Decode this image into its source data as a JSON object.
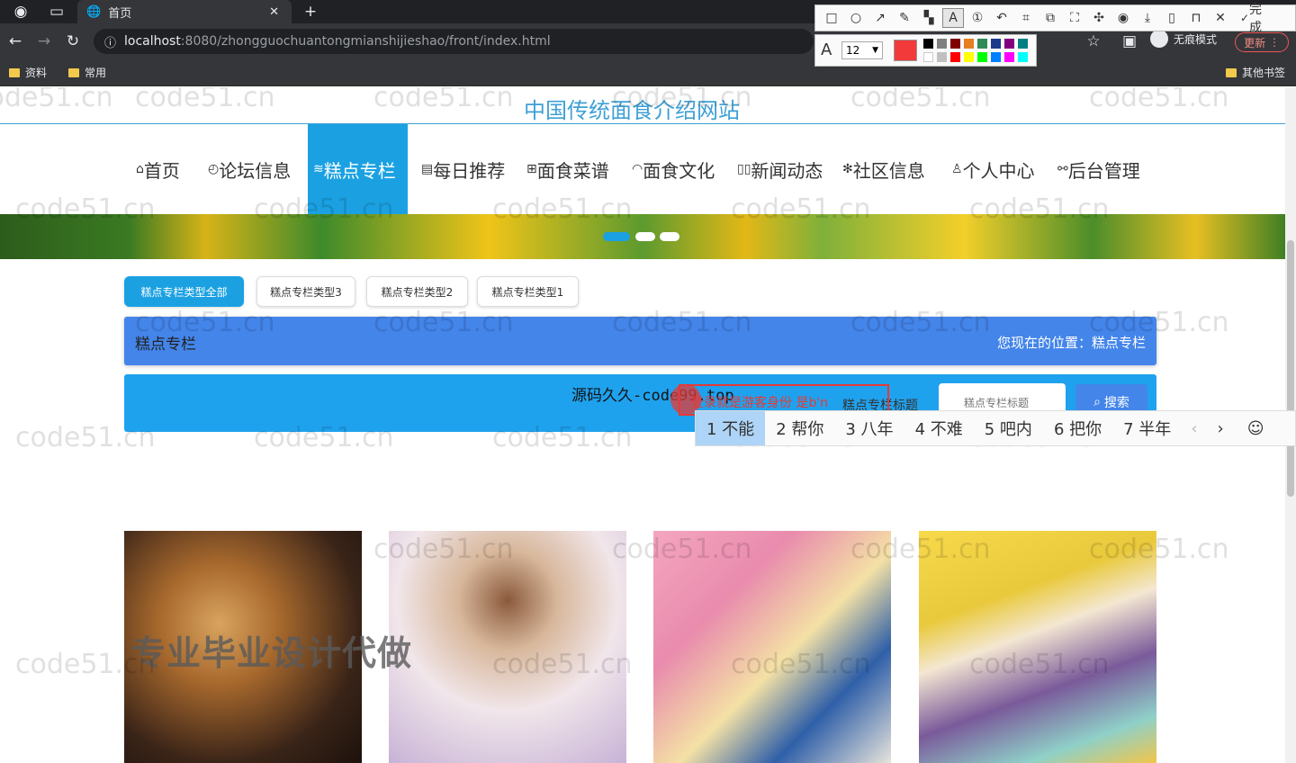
{
  "browser": {
    "tab_title": "首页",
    "url_host": "localhost",
    "url_path": ":8080/zhongguochuantongmianshijieshao/front/index.html",
    "bookmarks": [
      "资料",
      "常用"
    ],
    "other_bookmarks": "其他书签",
    "incognito_label": "无痕模式",
    "update_label": "更新"
  },
  "annotation_toolbar": {
    "done_label": "完成",
    "font_size": "12",
    "selected_color": "#f23a3a",
    "palette": [
      "#000000",
      "#808080",
      "#800000",
      "#e67e22",
      "#2e8b57",
      "#1e3a8a",
      "#800080",
      "#008080",
      "#ffffff",
      "#c0c0c0",
      "#ff0000",
      "#ffff00",
      "#00ff00",
      "#0080ff",
      "#ff00ff",
      "#00ffff"
    ]
  },
  "site": {
    "title": "中国传统面食介绍网站",
    "nav": [
      "首页",
      "论坛信息",
      "糕点专栏",
      "每日推荐",
      "面食菜谱",
      "面食文化",
      "新闻动态",
      "社区信息",
      "个人中心",
      "后台管理"
    ],
    "active_nav_index": 2
  },
  "filters": [
    "糕点专栏类型全部",
    "糕点专栏类型3",
    "糕点专栏类型2",
    "糕点专栏类型1"
  ],
  "breadcrumb": {
    "title": "糕点专栏",
    "location": "您现在的位置：糕点专栏"
  },
  "search": {
    "promo": "源码久久-code99.top",
    "label": "糕点专栏标题",
    "placeholder": "糕点专栏标题",
    "button": "搜索"
  },
  "typing_box": {
    "text": "登录就是游客身份  是b'n"
  },
  "ime": {
    "candidates": [
      "1 不能",
      "2 帮你",
      "3 八年",
      "4 不难",
      "5 吧内",
      "6 把你",
      "7 半年"
    ]
  },
  "overlay_text": "专业毕业设计代做",
  "watermark": "code51.cn"
}
